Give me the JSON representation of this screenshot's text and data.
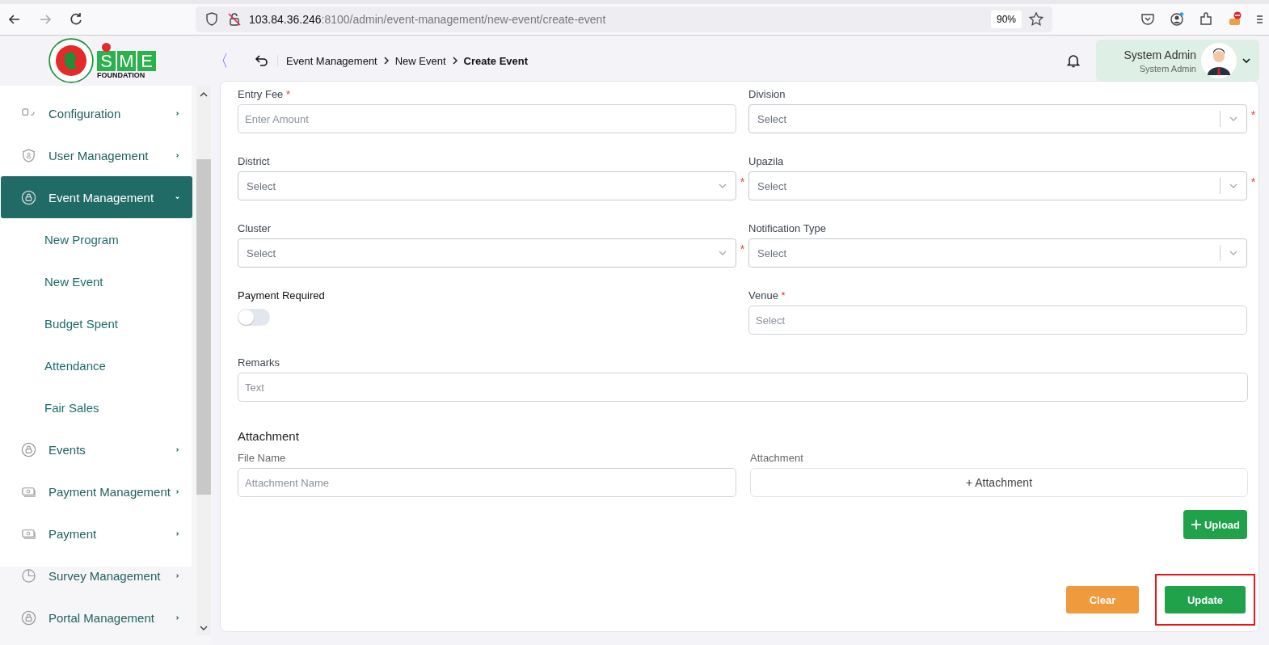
{
  "browser": {
    "url_host": "103.84.36.246",
    "url_rest": ":8100/admin/event-management/new-event/create-event",
    "zoom": "90%"
  },
  "logo": {
    "letters": [
      "S",
      "M",
      "E"
    ],
    "subtitle": "FOUNDATION"
  },
  "header": {
    "collapse": "〈",
    "breadcrumb": [
      "Event Management",
      "New Event"
    ],
    "current": "Create Event",
    "user": {
      "name": "System Admin",
      "role": "System Admin"
    }
  },
  "sidebar": {
    "items": [
      {
        "label": "Configuration",
        "selected": false,
        "expanded": false
      },
      {
        "label": "User Management",
        "selected": false,
        "expanded": false
      },
      {
        "label": "Event Management",
        "selected": true,
        "expanded": true,
        "children": [
          {
            "label": "New Program"
          },
          {
            "label": "New Event"
          },
          {
            "label": "Budget Spent"
          },
          {
            "label": "Attendance"
          },
          {
            "label": "Fair Sales"
          }
        ]
      },
      {
        "label": "Events",
        "selected": false,
        "expanded": false
      },
      {
        "label": "Payment Management",
        "selected": false,
        "expanded": false
      },
      {
        "label": "Payment",
        "selected": false,
        "expanded": false
      },
      {
        "label": "Survey Management",
        "selected": false,
        "expanded": false
      },
      {
        "label": "Portal Management",
        "selected": false,
        "expanded": false
      }
    ]
  },
  "form": {
    "fields": [
      {
        "label": "Entry Fee",
        "kind": "input",
        "mark": "*",
        "placeholder": "Enter Amount"
      },
      {
        "label": "Division",
        "kind": "select-split",
        "mark": "*",
        "placeholder": "Select"
      },
      {
        "label": "District",
        "kind": "select",
        "mark": "*",
        "placeholder": "Select"
      },
      {
        "label": "Upazila",
        "kind": "select-split",
        "mark": "*",
        "placeholder": "Select"
      },
      {
        "label": "Cluster",
        "kind": "select",
        "mark": "*",
        "placeholder": "Select"
      },
      {
        "label": "Notification Type",
        "kind": "select-split",
        "placeholder": "Select"
      },
      {
        "label": "Payment Required",
        "kind": "toggle",
        "on": false
      },
      {
        "label": "Venue",
        "kind": "input",
        "mark": "*",
        "placeholder": "Select"
      },
      {
        "label": "Remarks",
        "kind": "input-wide",
        "placeholder": "Text"
      }
    ],
    "attachment": {
      "heading": "Attachment",
      "file_label": "File Name",
      "file_placeholder": "Attachment Name",
      "attach_label": "Attachment",
      "attach_button": "+ Attachment",
      "upload": "Upload"
    },
    "buttons": [
      {
        "label": "Clear",
        "kind": "clear",
        "highlighted": false
      },
      {
        "label": "Update",
        "kind": "update",
        "highlighted": true
      }
    ]
  }
}
